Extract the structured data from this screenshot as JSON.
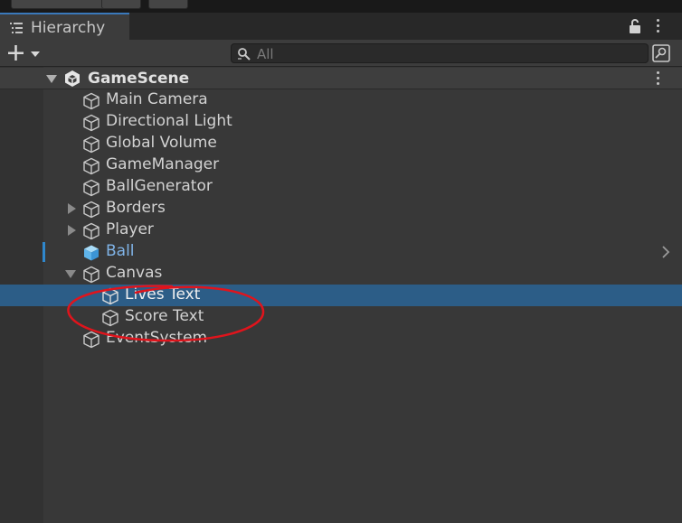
{
  "tab": {
    "title": "Hierarchy"
  },
  "search": {
    "placeholder": "All",
    "value": ""
  },
  "scene": {
    "name": "GameScene"
  },
  "items": [
    {
      "label": "Main Camera"
    },
    {
      "label": "Directional Light"
    },
    {
      "label": "Global Volume"
    },
    {
      "label": "GameManager"
    },
    {
      "label": "BallGenerator"
    },
    {
      "label": "Borders"
    },
    {
      "label": "Player"
    },
    {
      "label": "Ball"
    },
    {
      "label": "Canvas"
    },
    {
      "label": "Lives Text"
    },
    {
      "label": "Score Text"
    },
    {
      "label": "EventSystem"
    }
  ],
  "colors": {
    "selection": "#2c5d87",
    "prefab_text": "#80b4e8",
    "tab_accent": "#3a79bb",
    "annotation": "#e0141c"
  }
}
